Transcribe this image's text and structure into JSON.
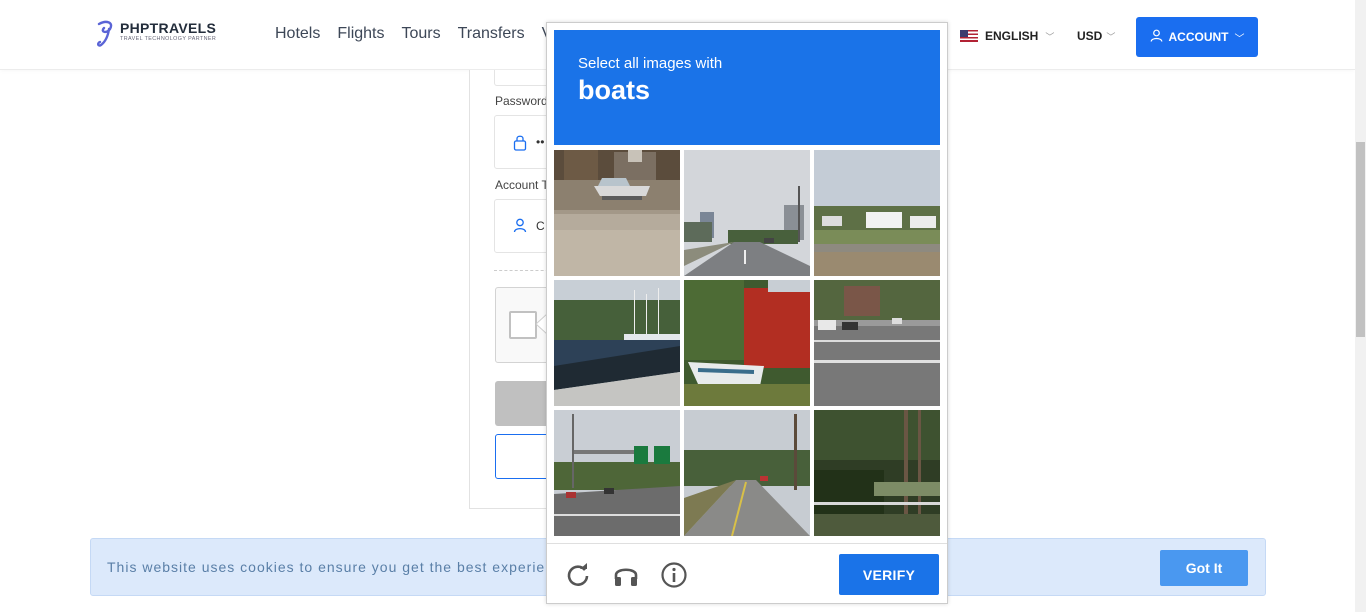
{
  "header": {
    "logo_name": "PHPTRAVELS",
    "logo_tagline": "TRAVEL TECHNOLOGY PARTNER",
    "nav": [
      "Hotels",
      "Flights",
      "Tours",
      "Transfers",
      "Vi"
    ],
    "language": "ENGLISH",
    "currency": "USD",
    "account": "ACCOUNT",
    "accent_color": "#1a6ef0"
  },
  "form": {
    "password_label": "Password",
    "password_value": "••",
    "account_type_label": "Account T",
    "account_type_value": "C"
  },
  "cookie": {
    "text": "This website uses cookies to ensure you get the best experien",
    "button": "Got It"
  },
  "challenge": {
    "instruction": "Select all images with",
    "target": "boats",
    "verify": "VERIFY",
    "header_color": "#1a73e8",
    "tiles": [
      "boat-on-sand",
      "road-street",
      "houses-shore",
      "marina-boats",
      "boat-red-barn",
      "street-intersection",
      "highway-signs",
      "road-trees",
      "trees-fence"
    ],
    "footer_icons": [
      "reload-icon",
      "audio-icon",
      "info-icon"
    ]
  }
}
